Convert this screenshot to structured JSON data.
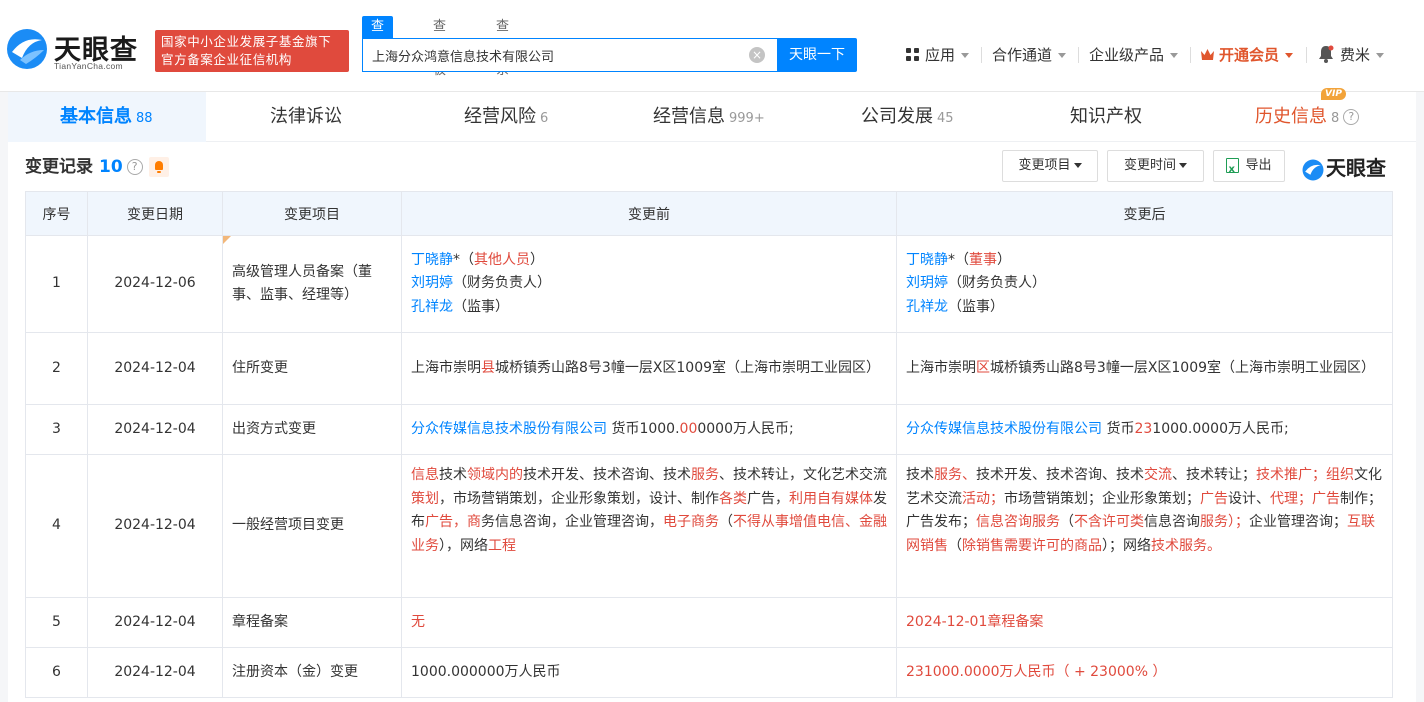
{
  "brand": {
    "name_cn": "天眼查",
    "name_en": "TianYanCha.com",
    "badge_line1": "国家中小企业发展子基金旗下",
    "badge_line2": "官方备案企业征信机构"
  },
  "search": {
    "tabs": [
      "查公司",
      "查老板",
      "查关系"
    ],
    "active_tab": 0,
    "value": "上海分众鸿意信息技术有限公司",
    "clear_glyph": "×",
    "button": "天眼一下"
  },
  "nav": {
    "apps": "应用",
    "partner": "合作通道",
    "enterprise": "企业级产品",
    "vip": "开通会员",
    "user": "费米"
  },
  "tabs": [
    {
      "label": "基本信息",
      "count": "88"
    },
    {
      "label": "法律诉讼",
      "count": ""
    },
    {
      "label": "经营风险",
      "count": "6"
    },
    {
      "label": "经营信息",
      "count": "999+"
    },
    {
      "label": "公司发展",
      "count": "45"
    },
    {
      "label": "知识产权",
      "count": ""
    },
    {
      "label": "历史信息",
      "count": "8",
      "tag": "VIP"
    }
  ],
  "section": {
    "title": "变更记录",
    "count": "10",
    "help": "?",
    "filter_item": "变更项目",
    "filter_time": "变更时间",
    "export": "导出",
    "watermark": "天眼查"
  },
  "table": {
    "headers": [
      "序号",
      "变更日期",
      "变更项目",
      "变更前",
      "变更后"
    ],
    "rows": [
      {
        "no": "1",
        "date": "2024-12-06",
        "item": "高级管理人员备案（董事、监事、经理等）",
        "before": [
          [
            {
              "t": "丁晓静",
              "c": "blue"
            },
            {
              "t": "*（"
            },
            {
              "t": "其他人员",
              "c": "red"
            },
            {
              "t": "）"
            }
          ],
          [
            {
              "t": "刘玥婷",
              "c": "blue"
            },
            {
              "t": "（财务负责人）"
            }
          ],
          [
            {
              "t": "孔祥龙",
              "c": "blue"
            },
            {
              "t": "（监事）"
            }
          ]
        ],
        "after": [
          [
            {
              "t": "丁晓静",
              "c": "blue"
            },
            {
              "t": "*（"
            },
            {
              "t": "董事",
              "c": "red"
            },
            {
              "t": "）"
            }
          ],
          [
            {
              "t": "刘玥婷",
              "c": "blue"
            },
            {
              "t": "（财务负责人）"
            }
          ],
          [
            {
              "t": "孔祥龙",
              "c": "blue"
            },
            {
              "t": "（监事）"
            }
          ]
        ]
      },
      {
        "no": "2",
        "date": "2024-12-04",
        "item": "住所变更",
        "before": [
          [
            {
              "t": "上海市崇明"
            },
            {
              "t": "县",
              "c": "red"
            },
            {
              "t": "城桥镇秀山路8号3幢一层X区1009室（上海市崇明工业园区）"
            }
          ]
        ],
        "after": [
          [
            {
              "t": "上海市崇明"
            },
            {
              "t": "区",
              "c": "red"
            },
            {
              "t": "城桥镇秀山路8号3幢一层X区1009室（上海市崇明工业园区）"
            }
          ]
        ]
      },
      {
        "no": "3",
        "date": "2024-12-04",
        "item": "出资方式变更",
        "before": [
          [
            {
              "t": "分众传媒信息技术股份有限公司",
              "c": "blue"
            },
            {
              "t": " 货币1000."
            },
            {
              "t": "00",
              "c": "red"
            },
            {
              "t": "0000万人民币;"
            }
          ]
        ],
        "after": [
          [
            {
              "t": "分众传媒信息技术股份有限公司",
              "c": "blue"
            },
            {
              "t": " 货币"
            },
            {
              "t": "23",
              "c": "red"
            },
            {
              "t": "1000.0000万人民币;"
            }
          ]
        ]
      },
      {
        "no": "4",
        "date": "2024-12-04",
        "item": "一般经营项目变更",
        "before": [
          [
            {
              "t": "信息",
              "c": "red"
            },
            {
              "t": "技术"
            },
            {
              "t": "领域内的",
              "c": "red"
            },
            {
              "t": "技术开发、技术咨询、技术"
            },
            {
              "t": "服务",
              "c": "red"
            },
            {
              "t": "、技术转让，文化艺术交流"
            },
            {
              "t": "策划",
              "c": "red"
            },
            {
              "t": "，市场营销策划，企业形象策划，设计、制作"
            },
            {
              "t": "各类",
              "c": "red"
            },
            {
              "t": "广告，"
            },
            {
              "t": "利用自有媒体",
              "c": "red"
            },
            {
              "t": "发布"
            },
            {
              "t": "广告，",
              "c": "red"
            },
            {
              "t": "商",
              "c": "red"
            },
            {
              "t": "务信息咨询，企业管理咨询，"
            },
            {
              "t": "电子商务",
              "c": "red"
            },
            {
              "t": "（"
            },
            {
              "t": "不得从事增值电信、金融业务",
              "c": "red"
            },
            {
              "t": "），"
            },
            {
              "t": "网络"
            },
            {
              "t": "工程",
              "c": "red"
            }
          ]
        ],
        "after": [
          [
            {
              "t": "技术"
            },
            {
              "t": "服务、",
              "c": "red"
            },
            {
              "t": "技术开发、技术咨询、技术"
            },
            {
              "t": "交流",
              "c": "red"
            },
            {
              "t": "、技术转让；"
            },
            {
              "t": "技术推广；组织",
              "c": "red"
            },
            {
              "t": "文化艺术交流"
            },
            {
              "t": "活动；",
              "c": "red"
            },
            {
              "t": "市场营销策划；企业形象策划；"
            },
            {
              "t": "广告",
              "c": "red"
            },
            {
              "t": "设计、"
            },
            {
              "t": "代理；广告",
              "c": "red"
            },
            {
              "t": "制作；广告发布；"
            },
            {
              "t": "信息咨询服务",
              "c": "red"
            },
            {
              "t": "（"
            },
            {
              "t": "不含许可类",
              "c": "red"
            },
            {
              "t": "信息咨询"
            },
            {
              "t": "服务）；",
              "c": "red"
            },
            {
              "t": "企业管理咨询；"
            },
            {
              "t": "互联网销售",
              "c": "red"
            },
            {
              "t": "（"
            },
            {
              "t": "除销售需要许可的商品",
              "c": "red"
            },
            {
              "t": "）；网络"
            },
            {
              "t": "技术服务。",
              "c": "red"
            }
          ]
        ]
      },
      {
        "no": "5",
        "date": "2024-12-04",
        "item": "章程备案",
        "before": [
          [
            {
              "t": "无",
              "c": "red"
            }
          ]
        ],
        "after": [
          [
            {
              "t": "2024-12-01章程备案",
              "c": "red"
            }
          ]
        ]
      },
      {
        "no": "6",
        "date": "2024-12-04",
        "item": "注册资本（金）变更",
        "before": [
          [
            {
              "t": "1000.000000万人民币"
            }
          ]
        ],
        "after": [
          [
            {
              "t": "231000.0000万人民币（ + 23000% ）",
              "c": "red"
            }
          ]
        ]
      }
    ]
  },
  "colors": {
    "accent": "#0084ff",
    "red": "#e04a3d",
    "orange": "#e0562d"
  }
}
